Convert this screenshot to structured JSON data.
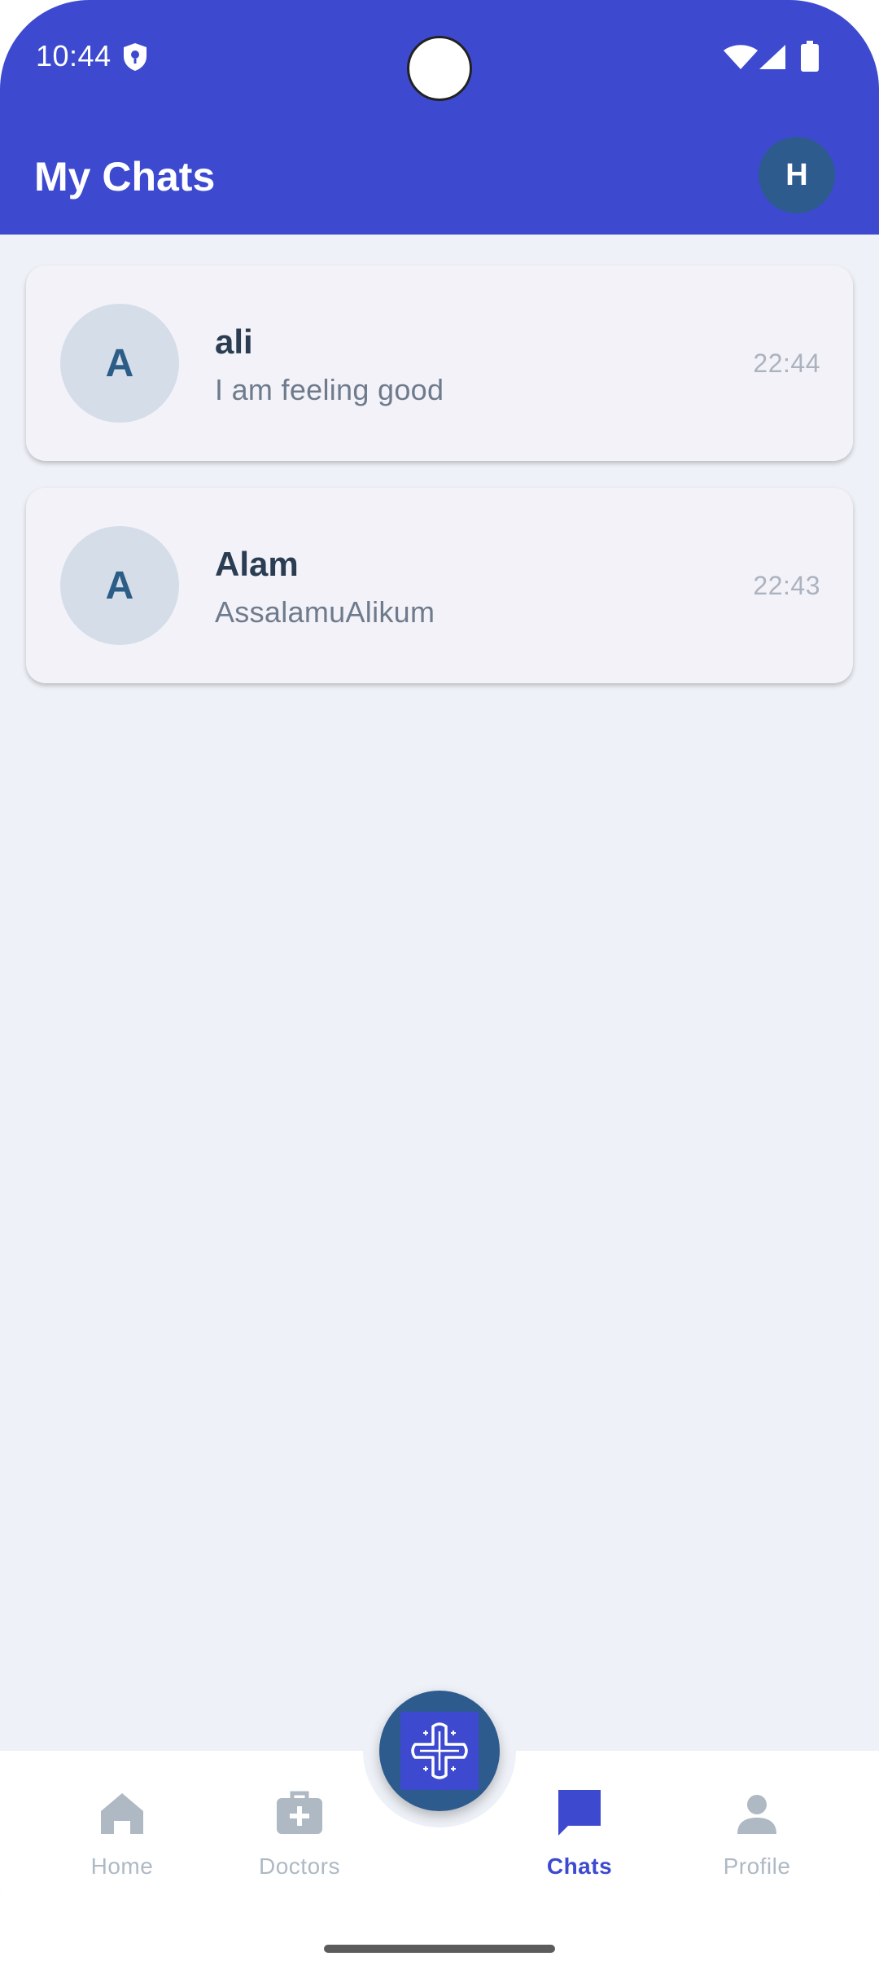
{
  "status_bar": {
    "time": "10:44"
  },
  "header": {
    "title": "My Chats",
    "avatar_initial": "H"
  },
  "chats": [
    {
      "initial": "A",
      "name": "ali",
      "last_message": "I am feeling good",
      "time": "22:44"
    },
    {
      "initial": "A",
      "name": "Alam",
      "last_message": "AssalamuAlikum",
      "time": "22:43"
    }
  ],
  "bottom_nav": {
    "items": [
      {
        "label": "Home",
        "icon": "home-icon",
        "active": false
      },
      {
        "label": "Doctors",
        "icon": "medical-bag-icon",
        "active": false
      },
      {
        "label": "Chats",
        "icon": "chat-bubble-icon",
        "active": true
      },
      {
        "label": "Profile",
        "icon": "person-icon",
        "active": false
      }
    ],
    "center_button_icon": "medical-cross-logo-icon"
  },
  "colors": {
    "primary": "#3d4ad0",
    "avatar_dark": "#2d5b8e",
    "background": "#eef1f7",
    "card": "#f3f2f8",
    "inactive": "#aeb9c4"
  }
}
